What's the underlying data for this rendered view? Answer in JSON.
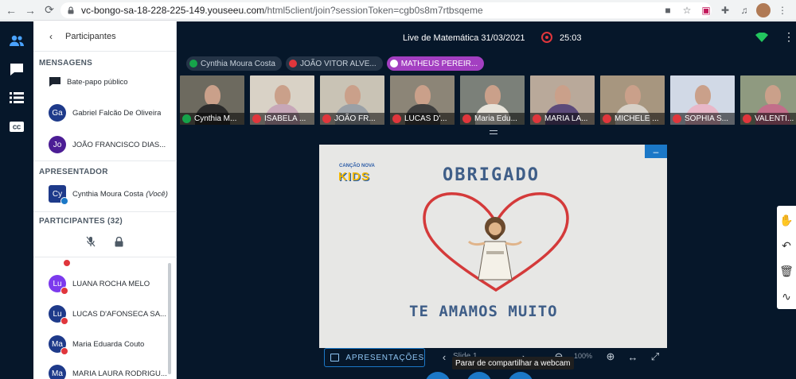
{
  "browser": {
    "url_host": "vc-bongo-sa-18-228-225-149.youseeu.com",
    "url_path": "/html5client/join?sessionToken=cgb0s8m7rtbsqeme"
  },
  "sidebar": {
    "header_title": "Participantes",
    "messages_title": "MENSAGENS",
    "public_chat": "Bate-papo público",
    "messages": [
      {
        "initials": "Ga",
        "name": "Gabriel Falcão De Oliveira",
        "color": "#1e3a8a"
      },
      {
        "initials": "Jo",
        "name": "JOÃO FRANCISCO DIAS...",
        "color": "#4c1d95"
      }
    ],
    "presenter_title": "APRESENTADOR",
    "presenter": {
      "initials": "Cy",
      "name": "Cynthia Moura Costa",
      "you": "(Você)",
      "color": "#1e3a8a"
    },
    "participants_title": "PARTICIPANTES (32)",
    "participants": [
      {
        "initials": "Lu",
        "name": "LUANA ROCHA MELO",
        "color": "#7c3aed"
      },
      {
        "initials": "Lu",
        "name": "LUCAS D'AFONSECA SA...",
        "color": "#1e3a8a"
      },
      {
        "initials": "Ma",
        "name": "Maria Eduarda Couto",
        "color": "#1e3a8a"
      },
      {
        "initials": "Ma",
        "name": "MARIA LAURA RODRIGU...",
        "color": "#1e3a8a"
      }
    ]
  },
  "meeting": {
    "title": "Live de Matemática 31/03/2021",
    "timer": "25:03"
  },
  "talkers": [
    {
      "name": "Cynthia Moura Costa",
      "state": "on"
    },
    {
      "name": "JOÃO VITOR ALVE...",
      "state": "muted"
    },
    {
      "name": "MATHEUS PEREIR...",
      "state": "active"
    }
  ],
  "tiles": [
    {
      "name": "Cynthia M...",
      "mic": "on",
      "bg": "#6d6a5f",
      "shirt": "#2b2b2b"
    },
    {
      "name": "ISABELA ...",
      "mic": "off",
      "bg": "#d9d2c6",
      "shirt": "#c7a7b8"
    },
    {
      "name": "JOÃO FR...",
      "mic": "off",
      "bg": "#c9c3b5",
      "shirt": "#9aa0a6"
    },
    {
      "name": "LUCAS D'...",
      "mic": "off",
      "bg": "#8c8577",
      "shirt": "#3f3f3f"
    },
    {
      "name": "Maria Edu...",
      "mic": "off",
      "bg": "#7b8079",
      "shirt": "#e7e3da"
    },
    {
      "name": "MARIA LA...",
      "mic": "off",
      "bg": "#b9a99a",
      "shirt": "#5c4a7a"
    },
    {
      "name": "MICHELE ...",
      "mic": "off",
      "bg": "#a7967f",
      "shirt": "#d7d0c7"
    },
    {
      "name": "SOPHIA S...",
      "mic": "off",
      "bg": "#d1d9e6",
      "shirt": "#e8b7c8"
    },
    {
      "name": "VALENTI...",
      "mic": "off",
      "bg": "#8f9a80",
      "shirt": "#c26e8a"
    }
  ],
  "slide": {
    "brand_small": "CANÇÃO NOVA",
    "brand": "KIDS",
    "title": "OBRIGADO",
    "subtitle": "TE AMAMOS MUITO",
    "page": "Slide 1",
    "zoom": "100%"
  },
  "toolbar": {
    "presentations_label": "APRESENTAÇÕES",
    "tooltip": "Parar de compartilhar a webcam"
  }
}
